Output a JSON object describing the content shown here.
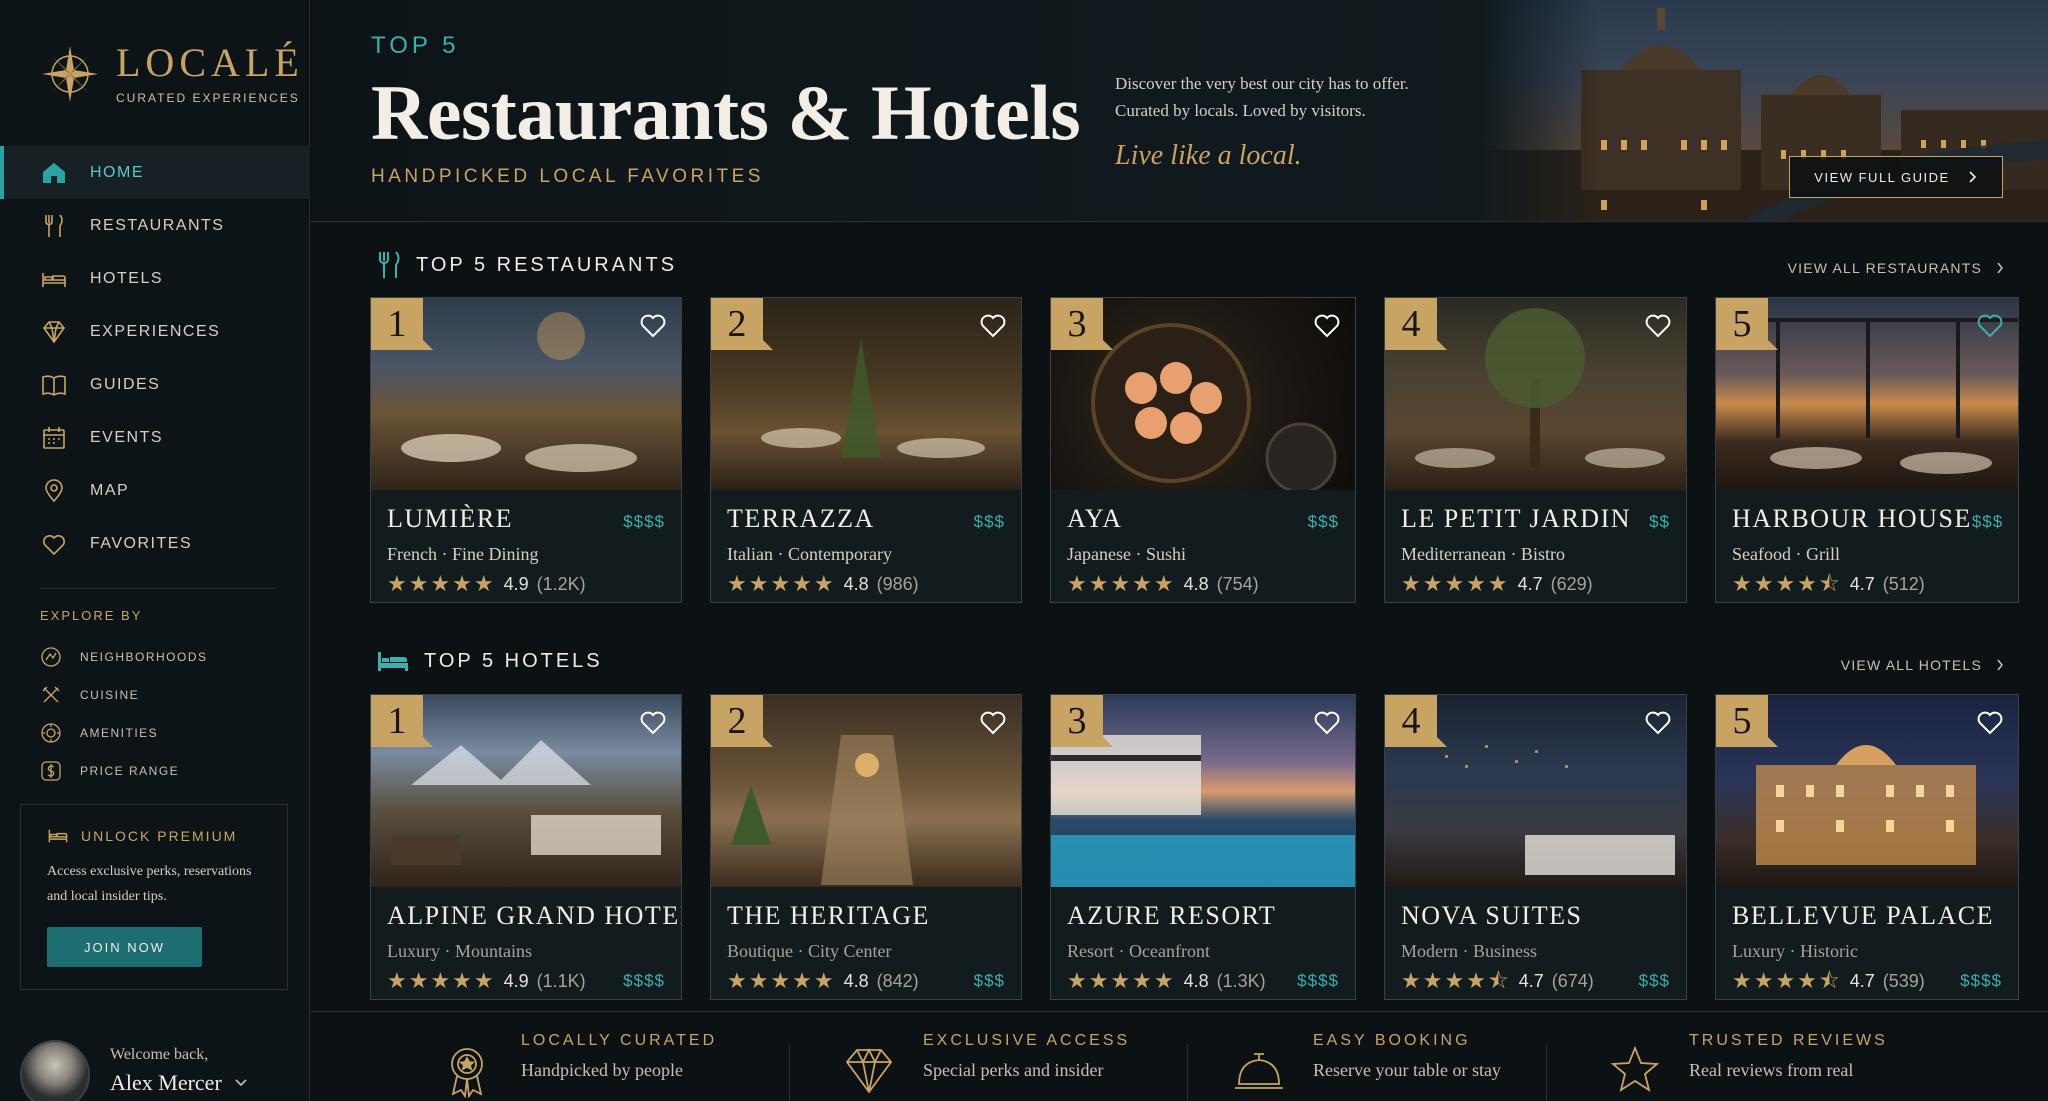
{
  "brand": {
    "name": "LOCALÉ",
    "tagline": "CURATED EXPERIENCES"
  },
  "nav": [
    {
      "id": "home",
      "label": "HOME",
      "icon": "home-icon",
      "active": true
    },
    {
      "id": "restaurants",
      "label": "RESTAURANTS",
      "icon": "fork-knife-icon"
    },
    {
      "id": "hotels",
      "label": "HOTELS",
      "icon": "bed-icon"
    },
    {
      "id": "experiences",
      "label": "EXPERIENCES",
      "icon": "diamond-icon"
    },
    {
      "id": "guides",
      "label": "GUIDES",
      "icon": "book-icon"
    },
    {
      "id": "events",
      "label": "EVENTS",
      "icon": "calendar-icon"
    },
    {
      "id": "map",
      "label": "MAP",
      "icon": "map-pin-icon"
    },
    {
      "id": "favorites",
      "label": "FAVORITES",
      "icon": "heart-icon"
    }
  ],
  "explore": {
    "title": "EXPLORE BY",
    "items": [
      {
        "label": "NEIGHBORHOODS",
        "icon": "neighborhood-icon"
      },
      {
        "label": "CUISINE",
        "icon": "utensils-cross-icon"
      },
      {
        "label": "AMENITIES",
        "icon": "amenities-icon"
      },
      {
        "label": "PRICE RANGE",
        "icon": "dollar-icon"
      }
    ]
  },
  "premium": {
    "title": "UNLOCK PREMIUM",
    "text": "Access exclusive perks, reservations and local insider tips.",
    "button": "JOIN NOW"
  },
  "user": {
    "welcome": "Welcome back,",
    "name": "Alex Mercer"
  },
  "header": {
    "eyebrow": "TOP 5",
    "title": "Restaurants & Hotels",
    "subtitle": "HANDPICKED LOCAL FAVORITES",
    "intro_line1": "Discover the very best our city has to offer.",
    "intro_line2": "Curated by locals.  Loved by visitors.",
    "tagline": "Live like a local.",
    "cta": "VIEW FULL GUIDE"
  },
  "restaurants": {
    "title": "TOP 5 RESTAURANTS",
    "view_all": "VIEW ALL RESTAURANTS",
    "items": [
      {
        "rank": "1",
        "name": "LUMIÈRE",
        "price": "$$$$",
        "category": "French · Fine Dining",
        "rating": "4.9",
        "reviews": "(1.2K)",
        "stars": "★★★★★"
      },
      {
        "rank": "2",
        "name": "TERRAZZA",
        "price": "$$$",
        "category": "Italian · Contemporary",
        "rating": "4.8",
        "reviews": "(986)",
        "stars": "★★★★★"
      },
      {
        "rank": "3",
        "name": "AYA",
        "price": "$$$",
        "category": "Japanese · Sushi",
        "rating": "4.8",
        "reviews": "(754)",
        "stars": "★★★★★"
      },
      {
        "rank": "4",
        "name": "LE PETIT JARDIN",
        "price": "$$",
        "category": "Mediterranean · Bistro",
        "rating": "4.7",
        "reviews": "(629)",
        "stars": "★★★★★"
      },
      {
        "rank": "5",
        "name": "HARBOUR HOUSE",
        "price": "$$$",
        "category": "Seafood · Grill",
        "rating": "4.7",
        "reviews": "(512)",
        "stars": "★★★★⯪"
      }
    ]
  },
  "hotels": {
    "title": "TOP 5 HOTELS",
    "view_all": "VIEW ALL HOTELS",
    "items": [
      {
        "rank": "1",
        "name": "ALPINE GRAND HOTEL",
        "price": "$$$$",
        "category": "Luxury · Mountains",
        "rating": "4.9",
        "reviews": "(1.1K)",
        "stars": "★★★★★"
      },
      {
        "rank": "2",
        "name": "THE HERITAGE",
        "price": "$$$",
        "category": "Boutique · City Center",
        "rating": "4.8",
        "reviews": "(842)",
        "stars": "★★★★★"
      },
      {
        "rank": "3",
        "name": "AZURE RESORT",
        "price": "$$$$",
        "category": "Resort · Oceanfront",
        "rating": "4.8",
        "reviews": "(1.3K)",
        "stars": "★★★★★"
      },
      {
        "rank": "4",
        "name": "NOVA SUITES",
        "price": "$$$",
        "category": "Modern · Business",
        "rating": "4.7",
        "reviews": "(674)",
        "stars": "★★★★⯪"
      },
      {
        "rank": "5",
        "name": "BELLEVUE PALACE",
        "price": "$$$$",
        "category": "Luxury · Historic",
        "rating": "4.7",
        "reviews": "(539)",
        "stars": "★★★★⯪"
      }
    ]
  },
  "features": [
    {
      "title": "LOCALLY CURATED",
      "text": "Handpicked by people",
      "icon": "award-ribbon-icon"
    },
    {
      "title": "EXCLUSIVE ACCESS",
      "text": "Special perks and insider",
      "icon": "diamond-icon"
    },
    {
      "title": "EASY BOOKING",
      "text": "Reserve your table or stay",
      "icon": "service-bell-icon"
    },
    {
      "title": "TRUSTED REVIEWS",
      "text": "Real reviews from real",
      "icon": "star-icon"
    }
  ],
  "colors": {
    "gold": "#c8a464",
    "teal": "#3bb0ad",
    "background": "#0c1114"
  }
}
